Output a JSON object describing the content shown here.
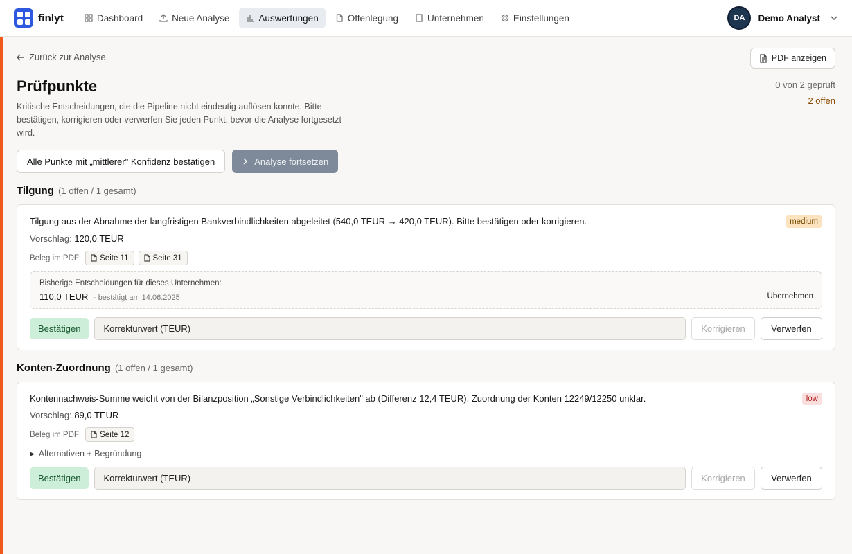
{
  "brand": {
    "name": "finlyt"
  },
  "nav": {
    "items": [
      {
        "label": "Dashboard",
        "icon": "grid-icon"
      },
      {
        "label": "Neue Analyse",
        "icon": "upload-icon"
      },
      {
        "label": "Auswertungen",
        "icon": "bar-chart-icon",
        "active": true
      },
      {
        "label": "Offenlegung",
        "icon": "document-icon"
      },
      {
        "label": "Unternehmen",
        "icon": "building-icon"
      },
      {
        "label": "Einstellungen",
        "icon": "gear-icon"
      }
    ]
  },
  "user": {
    "initials": "DA",
    "name": "Demo Analyst"
  },
  "page": {
    "back": "Zurück zur Analyse",
    "pdf_button": "PDF anzeigen",
    "title": "Prüfpunkte",
    "subtitle": "Kritische Entscheidungen, die die Pipeline nicht eindeutig auflösen konnte. Bitte bestätigen, korrigieren oder verwerfen Sie jeden Punkt, bevor die Analyse fortgesetzt wird.",
    "checked": "0 von 2 geprüft",
    "open": "2 offen",
    "confirm_all": "Alle Punkte mit „mittlerer\" Konfidenz bestätigen",
    "continue": "Analyse fortsetzen"
  },
  "sections": [
    {
      "title": "Tilgung",
      "count": "(1 offen / 1 gesamt)",
      "card": {
        "description": "Tilgung aus der Abnahme der langfristigen Bankverbindlichkeiten abgeleitet (540,0 TEUR → 420,0 TEUR). Bitte bestätigen oder korrigieren.",
        "badge": "medium",
        "suggest_label": "Vorschlag:",
        "suggest_value": "120,0 TEUR",
        "beleg_label": "Beleg im PDF:",
        "pages": [
          "Seite 11",
          "Seite 31"
        ],
        "history": {
          "label": "Bisherige Entscheidungen für dieses Unternehmen:",
          "value": "110,0 TEUR",
          "date": "· bestätigt am 14.06.2025",
          "apply": "Übernehmen"
        },
        "confirm": "Bestätigen",
        "correction_placeholder": "Korrekturwert (TEUR)",
        "correct": "Korrigieren",
        "reject": "Verwerfen"
      }
    },
    {
      "title": "Konten-Zuordnung",
      "count": "(1 offen / 1 gesamt)",
      "card": {
        "description": "Kontennachweis-Summe weicht von der Bilanzposition „Sonstige Verbindlichkeiten\" ab (Differenz 12,4 TEUR). Zuordnung der Konten 12249/12250 unklar.",
        "badge": "low",
        "suggest_label": "Vorschlag:",
        "suggest_value": "89,0 TEUR",
        "beleg_label": "Beleg im PDF:",
        "pages": [
          "Seite 12"
        ],
        "alternatives": "Alternativen + Begründung",
        "confirm": "Bestätigen",
        "correction_placeholder": "Korrekturwert (TEUR)",
        "correct": "Korrigieren",
        "reject": "Verwerfen"
      }
    }
  ],
  "colors": {
    "accent": "#f05a1a",
    "brand": "#2f58e0",
    "confirm_bg": "#cdeed8",
    "badge_medium": "#fbe3c0",
    "badge_low": "#fbdede"
  }
}
